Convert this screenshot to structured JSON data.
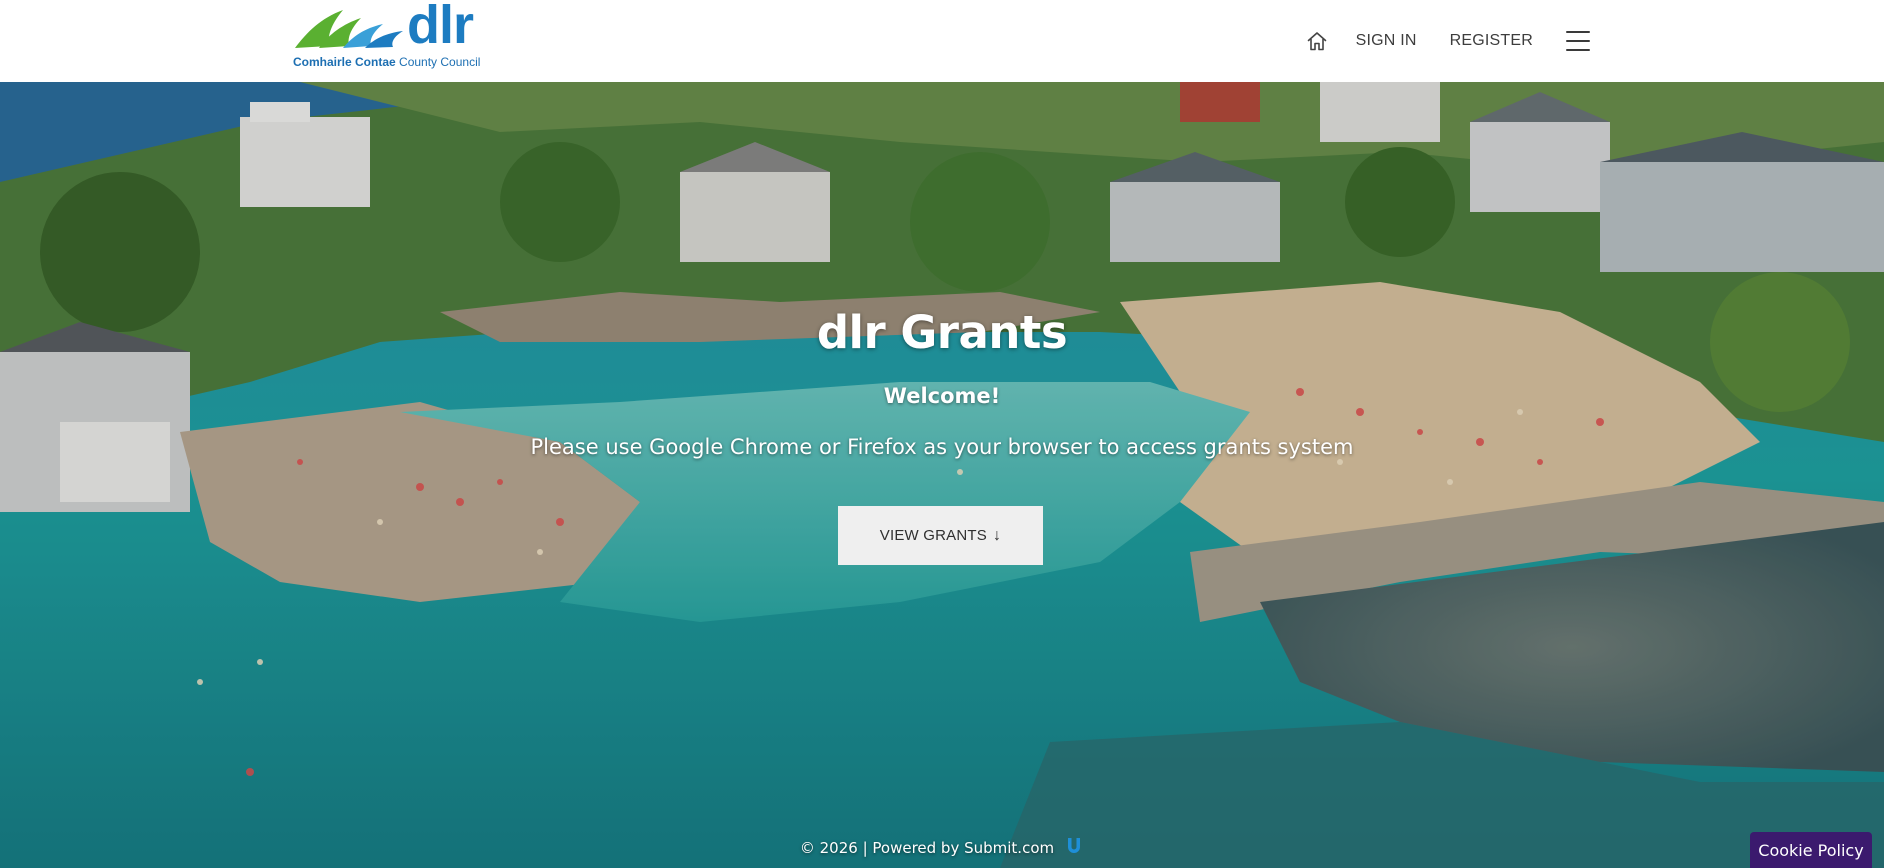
{
  "header": {
    "logo": {
      "brand": "dlr",
      "subtitle_bold": "Comhairle Contae",
      "subtitle_rest": "County Council",
      "colors": {
        "green": "#5ab031",
        "blue": "#1d7cc1"
      }
    },
    "nav": {
      "home_icon": "home-icon",
      "signin_label": "SIGN IN",
      "register_label": "REGISTER",
      "menu_icon": "hamburger-menu-icon"
    }
  },
  "hero": {
    "title": "dlr Grants",
    "welcome": "Welcome!",
    "note": "Please use Google Chrome or Firefox as your browser to access grants system",
    "button_label": "VIEW GRANTS",
    "button_arrow": "↓"
  },
  "footer": {
    "credit": "© 2026 | Powered by Submit.com",
    "credit_icon": "submit-logo-icon"
  },
  "cookie": {
    "label": "Cookie Policy",
    "color": "#3b1a6e"
  }
}
